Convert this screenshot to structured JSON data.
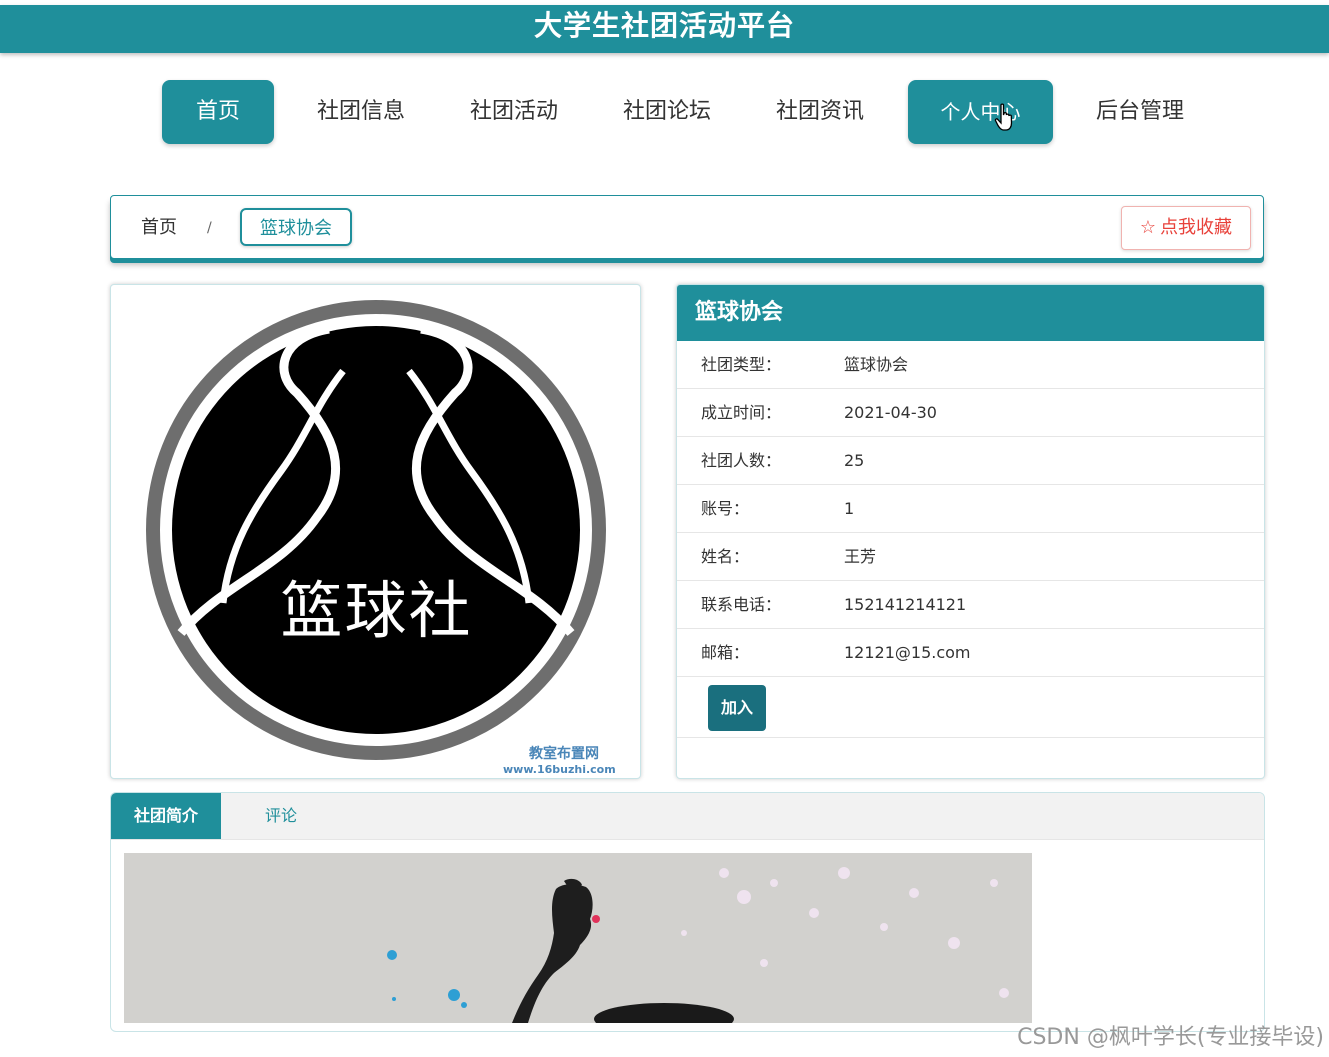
{
  "header": {
    "title": "大学生社团活动平台"
  },
  "nav": {
    "items": [
      "首页",
      "社团信息",
      "社团活动",
      "社团论坛",
      "社团资讯",
      "个人中心",
      "后台管理"
    ]
  },
  "breadcrumb": {
    "home": "首页",
    "separator": "/",
    "current": "篮球协会"
  },
  "favorite": {
    "label": "点我收藏",
    "icon": "star-outline-icon"
  },
  "logo": {
    "text": "篮球社",
    "watermark_line1": "教室布置网",
    "watermark_line2": "www.16buzhi.com"
  },
  "club": {
    "name": "篮球协会",
    "fields": [
      {
        "label": "社团类型：",
        "value": "篮球协会"
      },
      {
        "label": "成立时间：",
        "value": "2021-04-30"
      },
      {
        "label": "社团人数：",
        "value": "25"
      },
      {
        "label": "账号：",
        "value": "1"
      },
      {
        "label": "姓名：",
        "value": "王芳"
      },
      {
        "label": "联系电话：",
        "value": "152141214121"
      },
      {
        "label": "邮箱：",
        "value": "12121@15.com"
      }
    ],
    "join_label": "加入"
  },
  "tabs": {
    "items": [
      "社团简介",
      "评论"
    ]
  },
  "footer": {
    "watermark": "CSDN @枫叶学长(专业接毕设)"
  },
  "colors": {
    "primary": "#1f8f9b",
    "dark_button": "#1a6f7e",
    "favorite": "#e8413a"
  }
}
